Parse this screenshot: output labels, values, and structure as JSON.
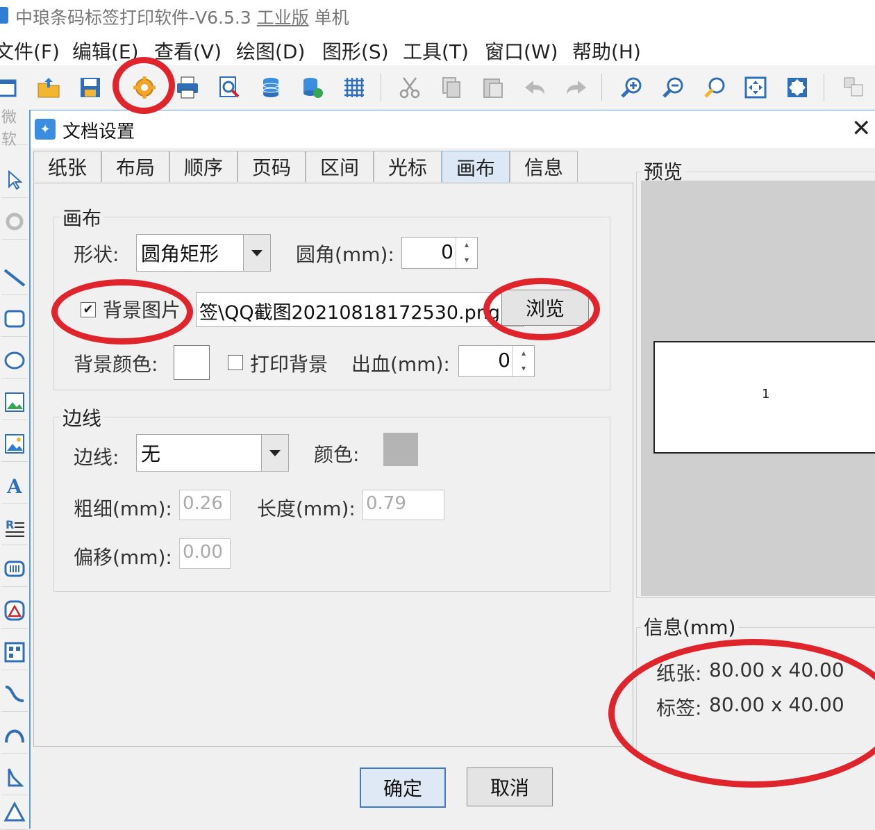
{
  "window": {
    "title": "中琅条码标签打印软件-V6.5.3",
    "edition": "工业版",
    "mode": "单机"
  },
  "menu": [
    "文件(F)",
    "编辑(E)",
    "查看(V)",
    "绘图(D)",
    "图形(S)",
    "工具(T)",
    "窗口(W)",
    "帮助(H)"
  ],
  "toolbar": {
    "icons": [
      "new-icon",
      "open-icon",
      "save-icon",
      "document-settings-icon",
      "print-icon",
      "print-preview-icon",
      "database-icon",
      "database-settings-icon",
      "grid-icon",
      "cut-icon",
      "copy-icon",
      "paste-icon",
      "undo-icon",
      "redo-icon",
      "zoom-in-icon",
      "zoom-out-icon",
      "zoom-icon",
      "fit-page-icon",
      "actual-size-icon",
      "layers-icon"
    ]
  },
  "leftbar": {
    "partial_label": "微软"
  },
  "dialog": {
    "title": "文档设置",
    "tabs": [
      "纸张",
      "布局",
      "顺序",
      "页码",
      "区间",
      "光标",
      "画布",
      "信息"
    ],
    "active_tab": "画布",
    "canvas": {
      "group_label": "画布",
      "shape_label": "形状:",
      "shape_value": "圆角矩形",
      "corner_label": "圆角(mm):",
      "corner_value": "0",
      "bg_image_label": "背景图片",
      "bg_image_checked": true,
      "bg_image_path": "签\\QQ截图20210818172530.png",
      "browse_label": "浏览",
      "bg_color_label": "背景颜色:",
      "print_bg_label": "打印背景",
      "print_bg_checked": false,
      "bleed_label": "出血(mm):",
      "bleed_value": "0"
    },
    "border": {
      "group_label": "边线",
      "border_label": "边线:",
      "border_value": "无",
      "color_label": "颜色:",
      "color_value": "#b4b4b4",
      "thickness_label": "粗细(mm):",
      "thickness_value": "0.26",
      "length_label": "长度(mm):",
      "length_value": "0.79",
      "offset_label": "偏移(mm):",
      "offset_value": "0.00"
    },
    "preview": {
      "label": "预览",
      "page_number": "1"
    },
    "info": {
      "label": "信息(mm)",
      "paper_label": "纸张:",
      "paper_value": "80.00 x 40.00",
      "tag_label": "标签:",
      "tag_value": "80.00 x 40.00"
    },
    "ok_label": "确定",
    "cancel_label": "取消"
  },
  "colors": {
    "annotation_red": "#e0242b",
    "tab_active_bg": "#dce8f5",
    "preview_bg": "#cfcfcf"
  }
}
